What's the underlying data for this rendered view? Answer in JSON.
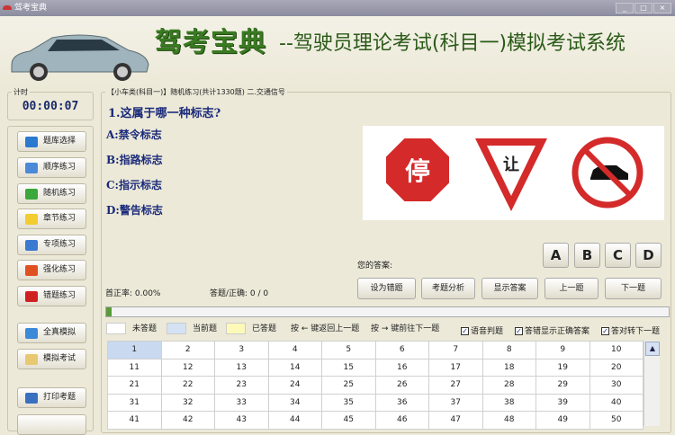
{
  "window": {
    "title": "驾考宝典",
    "controls": [
      "_",
      "□",
      "×"
    ]
  },
  "header": {
    "title": "驾考宝典",
    "subtitle": "--驾驶员理论考试(科目一)模拟考试系统"
  },
  "timer": {
    "label": "计时",
    "value": "00:00:07"
  },
  "sidebar": {
    "items": [
      {
        "label": "题库选择",
        "icon": "cubes-icon",
        "color": "#2a7ad0"
      },
      {
        "label": "顺序练习",
        "icon": "edit-icon",
        "color": "#4a8ad8"
      },
      {
        "label": "随机练习",
        "icon": "refresh-icon",
        "color": "#3aa83a"
      },
      {
        "label": "章节练习",
        "icon": "note-icon",
        "color": "#f2cc30"
      },
      {
        "label": "专项练习",
        "icon": "calendar-check-icon",
        "color": "#3a7ad0"
      },
      {
        "label": "强化练习",
        "icon": "chart-icon",
        "color": "#e05020"
      },
      {
        "label": "错题练习",
        "icon": "flag-icon",
        "color": "#d02020"
      },
      {
        "label": "全真模拟",
        "icon": "dashboard-icon",
        "color": "#3a8ad8"
      },
      {
        "label": "模拟考试",
        "icon": "calendar-icon",
        "color": "#e8c870"
      },
      {
        "label": "打印考题",
        "icon": "printer-icon",
        "color": "#3a70c0"
      }
    ]
  },
  "question": {
    "group_label": "【小车类(科目一)】随机练习(共计1330题) 二.交通信号",
    "text": "1.这属于哪一种标志?",
    "options": [
      "A:禁令标志",
      "B:指路标志",
      "C:指示标志",
      "D:警告标志"
    ],
    "signs": [
      "停",
      "让"
    ]
  },
  "answer": {
    "label": "您的答案:",
    "choices": [
      "A",
      "B",
      "C",
      "D"
    ]
  },
  "stats": {
    "accuracy": "首正率: 0.00%",
    "answered": "答题/正确: 0 / 0"
  },
  "controls": [
    "设为错题",
    "考题分析",
    "显示答案",
    "上一题",
    "下一题"
  ],
  "progress": 0.01,
  "legend": {
    "unanswered": "未答题",
    "current": "当前题",
    "answered": "已答题",
    "hint_prev": "按 ← 键返回上一题",
    "hint_next": "按 → 键前往下一题",
    "checks": [
      {
        "label": "语音判题",
        "checked": true
      },
      {
        "label": "答错显示正确答案",
        "checked": true
      },
      {
        "label": "答对转下一题",
        "checked": true
      }
    ]
  },
  "grid": {
    "current": 1,
    "numbers": [
      [
        1,
        2,
        3,
        4,
        5,
        6,
        7,
        8,
        9,
        10
      ],
      [
        11,
        12,
        13,
        14,
        15,
        16,
        17,
        18,
        19,
        20
      ],
      [
        21,
        22,
        23,
        24,
        25,
        26,
        27,
        28,
        29,
        30
      ],
      [
        31,
        32,
        33,
        34,
        35,
        36,
        37,
        38,
        39,
        40
      ],
      [
        41,
        42,
        43,
        44,
        45,
        46,
        47,
        48,
        49,
        50
      ]
    ]
  }
}
